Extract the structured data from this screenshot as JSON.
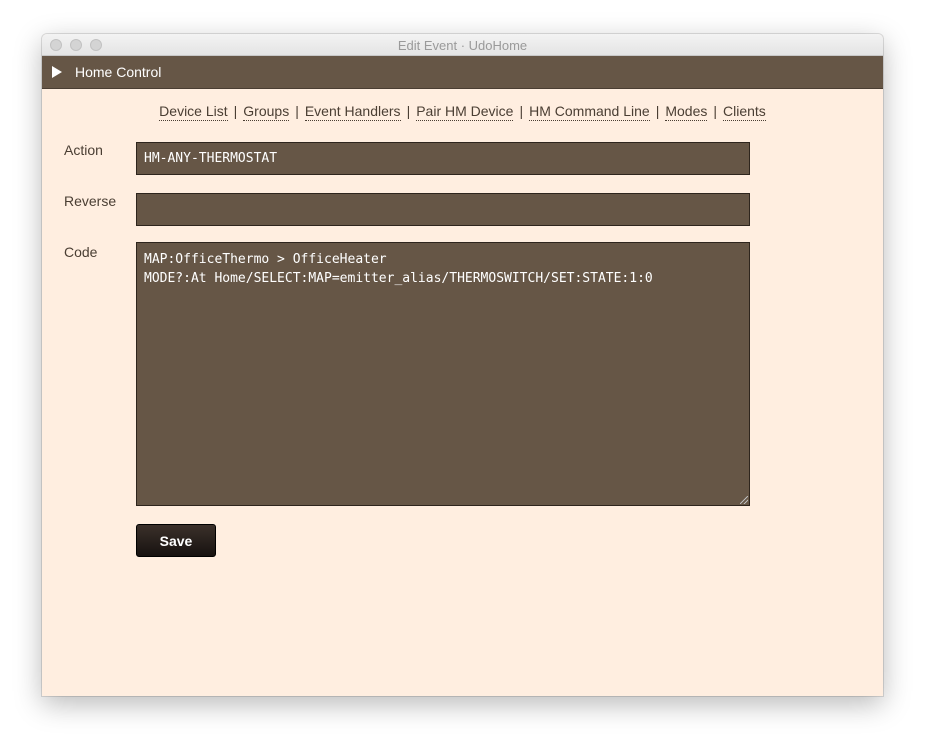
{
  "window": {
    "title": "Edit Event · UdoHome"
  },
  "header": {
    "title": "Home Control"
  },
  "nav": {
    "items": [
      {
        "label": "Device List"
      },
      {
        "label": "Groups"
      },
      {
        "label": "Event Handlers"
      },
      {
        "label": "Pair HM Device"
      },
      {
        "label": "HM Command Line"
      },
      {
        "label": "Modes"
      },
      {
        "label": "Clients"
      }
    ],
    "separator": "|"
  },
  "form": {
    "action": {
      "label": "Action",
      "value": "HM-ANY-THERMOSTAT"
    },
    "reverse": {
      "label": "Reverse",
      "value": ""
    },
    "code": {
      "label": "Code",
      "value": "MAP:OfficeThermo > OfficeHeater\nMODE?:At Home/SELECT:MAP=emitter_alias/THERMOSWITCH/SET:STATE:1:0"
    },
    "save_label": "Save"
  },
  "colors": {
    "background": "#ffeee0",
    "header": "#665646",
    "field": "#665646",
    "text": "#4a3e33"
  }
}
